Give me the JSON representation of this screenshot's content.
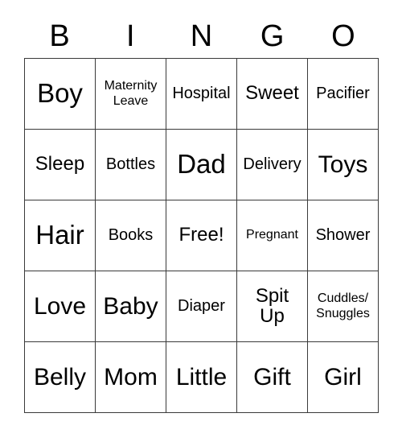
{
  "card": {
    "title": "BINGO",
    "header_letters": [
      "B",
      "I",
      "N",
      "G",
      "O"
    ],
    "grid": [
      [
        {
          "text": "Boy",
          "size": "fs-xl"
        },
        {
          "text": "Maternity\nLeave",
          "size": "fs-xs"
        },
        {
          "text": "Hospital",
          "size": "fs-sm"
        },
        {
          "text": "Sweet",
          "size": "fs-md"
        },
        {
          "text": "Pacifier",
          "size": "fs-sm"
        }
      ],
      [
        {
          "text": "Sleep",
          "size": "fs-md"
        },
        {
          "text": "Bottles",
          "size": "fs-sm"
        },
        {
          "text": "Dad",
          "size": "fs-xl"
        },
        {
          "text": "Delivery",
          "size": "fs-sm"
        },
        {
          "text": "Toys",
          "size": "fs-lg"
        }
      ],
      [
        {
          "text": "Hair",
          "size": "fs-xl"
        },
        {
          "text": "Books",
          "size": "fs-sm"
        },
        {
          "text": "Free!",
          "size": "fs-md"
        },
        {
          "text": "Pregnant",
          "size": "fs-xs"
        },
        {
          "text": "Shower",
          "size": "fs-sm"
        }
      ],
      [
        {
          "text": "Love",
          "size": "fs-lg"
        },
        {
          "text": "Baby",
          "size": "fs-lg"
        },
        {
          "text": "Diaper",
          "size": "fs-sm"
        },
        {
          "text": "Spit\nUp",
          "size": "fs-md"
        },
        {
          "text": "Cuddles/\nSnuggles",
          "size": "fs-xs"
        }
      ],
      [
        {
          "text": "Belly",
          "size": "fs-lg"
        },
        {
          "text": "Mom",
          "size": "fs-lg"
        },
        {
          "text": "Little",
          "size": "fs-lg"
        },
        {
          "text": "Gift",
          "size": "fs-lg"
        },
        {
          "text": "Girl",
          "size": "fs-lg"
        }
      ]
    ],
    "colors": {
      "background": "#ffffff",
      "text": "#000000",
      "grid_line": "#3a3a3a"
    }
  }
}
